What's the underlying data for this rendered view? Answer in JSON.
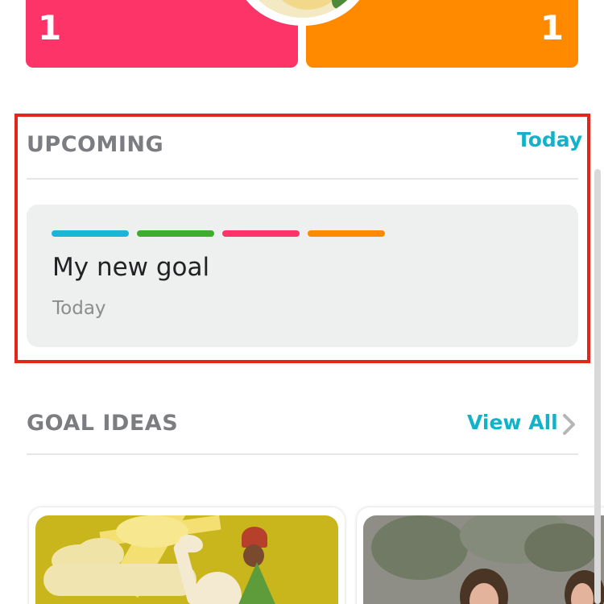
{
  "stats": {
    "left_value": "1",
    "right_value": "1"
  },
  "upcoming": {
    "title": "UPCOMING",
    "link": "Today",
    "goal": {
      "title": "My new goal",
      "date": "Today",
      "stripe_colors": [
        "#1bb6d3",
        "#3dae2b",
        "#fc3468",
        "#ff8a00"
      ]
    }
  },
  "goal_ideas": {
    "title": "GOAL IDEAS",
    "link": "View All"
  },
  "colors": {
    "pink": "#fc3468",
    "orange": "#ff8a00",
    "accent": "#12b2c9",
    "highlight": "#e2261a"
  }
}
